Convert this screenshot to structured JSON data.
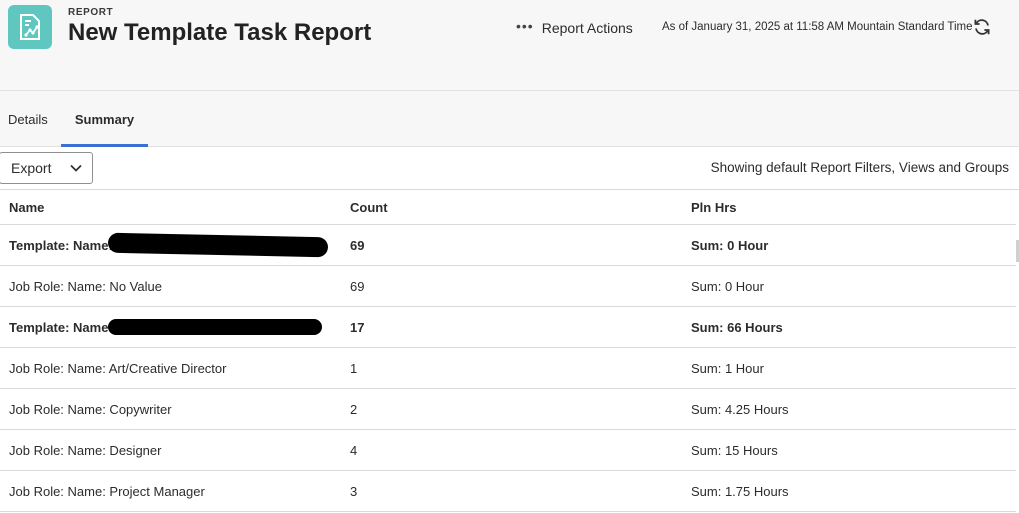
{
  "header": {
    "eyebrow": "REPORT",
    "title": "New Template Task Report",
    "actions_label": "Report Actions",
    "timestamp": "As of January 31, 2025 at 11:58 AM Mountain Standard Time",
    "icon_color": "#5fc6c0"
  },
  "tabs": [
    {
      "label": "Details",
      "active": false
    },
    {
      "label": "Summary",
      "active": true
    }
  ],
  "toolbar": {
    "export_label": "Export",
    "filters_note": "Showing default Report Filters, Views and Groups"
  },
  "table": {
    "columns": [
      "Name",
      "Count",
      "Pln Hrs"
    ],
    "rows": [
      {
        "name": "Template: Name:",
        "count": "69",
        "hours": "Sum: 0 Hour",
        "bold": true,
        "redacted": true
      },
      {
        "name": "Job Role: Name: No Value",
        "count": "69",
        "hours": "Sum: 0 Hour",
        "bold": false
      },
      {
        "name": "Template: Name:",
        "count": "17",
        "hours": "Sum: 66 Hours",
        "bold": true,
        "redacted": true
      },
      {
        "name": "Job Role: Name: Art/Creative Director",
        "count": "1",
        "hours": "Sum: 1 Hour",
        "bold": false
      },
      {
        "name": "Job Role: Name: Copywriter",
        "count": "2",
        "hours": "Sum: 4.25 Hours",
        "bold": false
      },
      {
        "name": "Job Role: Name: Designer",
        "count": "4",
        "hours": "Sum: 15 Hours",
        "bold": false
      },
      {
        "name": "Job Role: Name: Project Manager",
        "count": "3",
        "hours": "Sum: 1.75 Hours",
        "bold": false
      }
    ]
  },
  "accent_color": "#3b6fd1"
}
